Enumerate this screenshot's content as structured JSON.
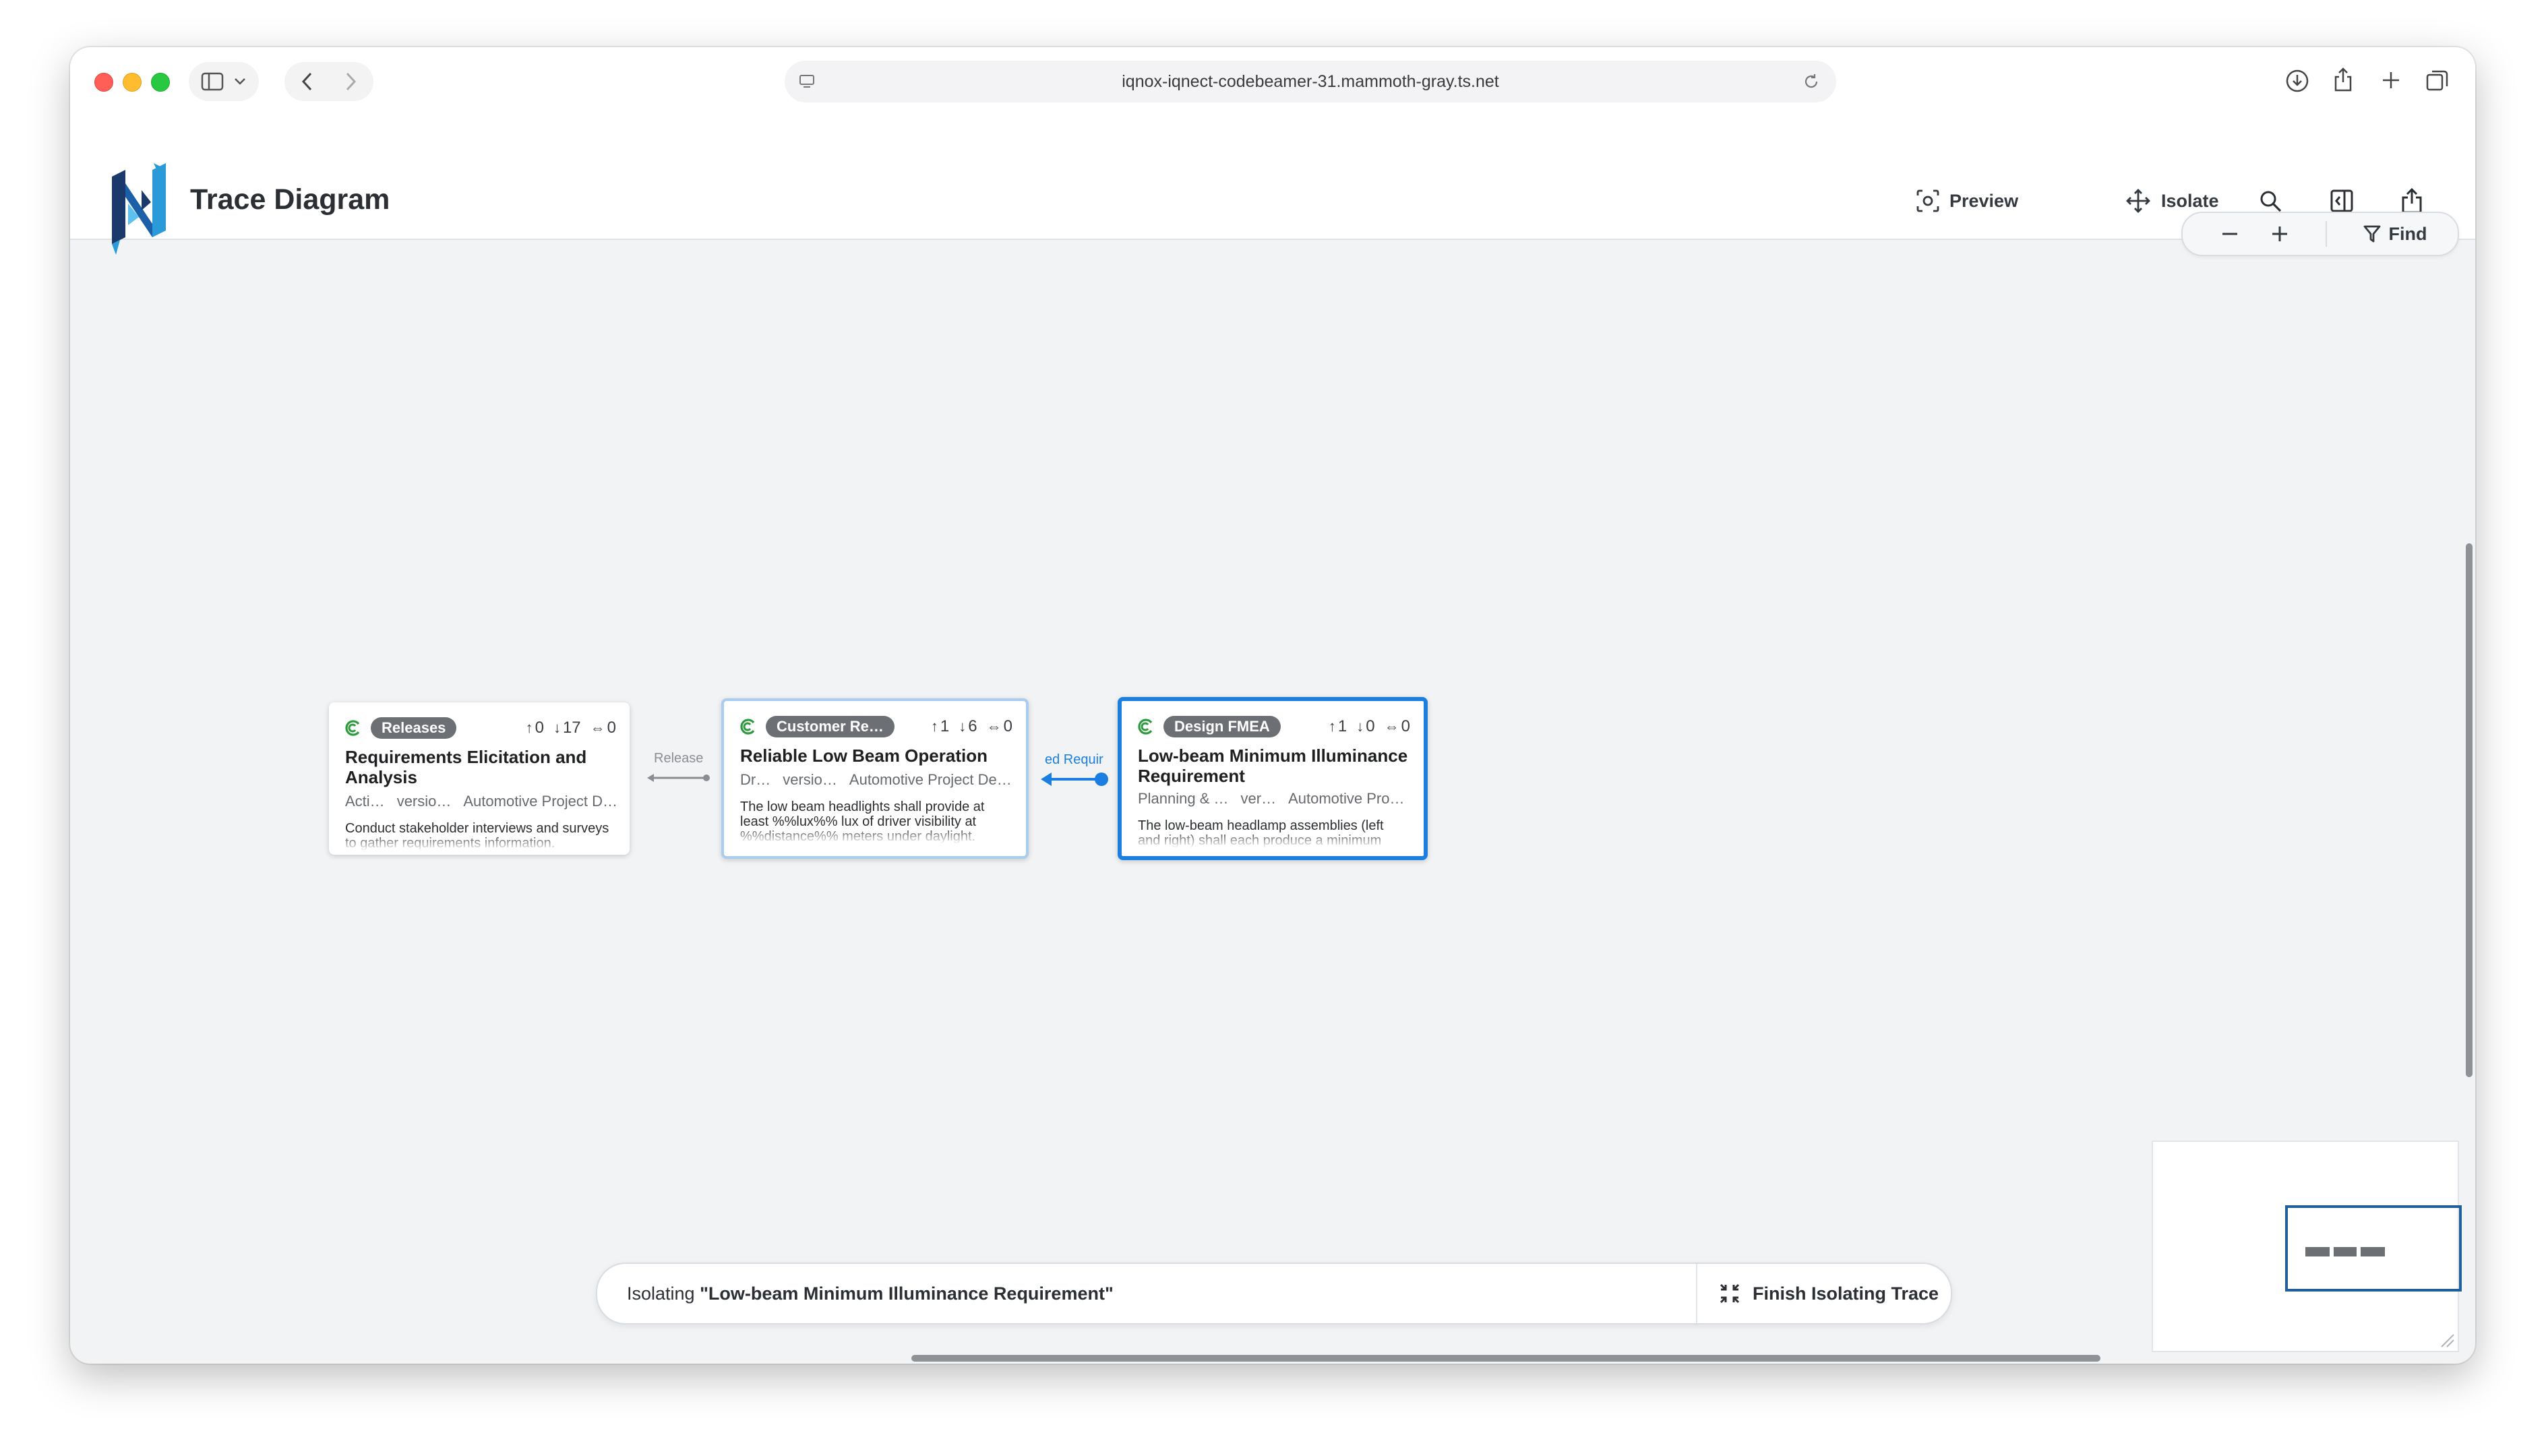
{
  "browser": {
    "url": "iqnox-iqnect-codebeamer-31.mammoth-gray.ts.net"
  },
  "app": {
    "title": "Trace Diagram",
    "logo": "iqnox-logo",
    "actions": {
      "preview": "Preview",
      "isolate": "Isolate"
    },
    "icons": [
      "search-icon",
      "panel-icon",
      "share-icon",
      "close-icon"
    ]
  },
  "canvas": {
    "zoom": {
      "find_label": "Find"
    },
    "nodes": [
      {
        "badge": "Releases",
        "up": "0",
        "down": "17",
        "links": "0",
        "title": "Requirements Elicitation and Analysis",
        "meta": [
          "Acti…",
          "versio…",
          "Automotive Project D…"
        ],
        "description": "Conduct stakeholder interviews and surveys to gather requirements information."
      },
      {
        "badge": "Customer Re…",
        "up": "1",
        "down": "6",
        "links": "0",
        "title": "Reliable Low Beam Operation",
        "meta": [
          "Dr…",
          "versio…",
          "Automotive Project De…"
        ],
        "description": "The low beam headlights shall provide at least %%lux%% lux of driver visibility at %%distance%% meters under daylight."
      },
      {
        "badge": "Design FMEA",
        "up": "1",
        "down": "0",
        "links": "0",
        "title": "Low-beam Minimum Illuminance Requirement",
        "meta": [
          "Planning & …",
          "ver…",
          "Automotive Pro…"
        ],
        "description": "The low-beam headlamp assemblies (left and right) shall each produce a minimum"
      }
    ],
    "edges": [
      {
        "label": "Release",
        "color": "#8a8e93"
      },
      {
        "label": "ed Requir",
        "color": "#1a7fe0"
      }
    ]
  },
  "isolate_bar": {
    "prefix": "Isolating ",
    "item": "\"Low-beam Minimum Illuminance Requirement\"",
    "finish_label": "Finish Isolating Trace"
  },
  "colors": {
    "accent": "#1a7fe0",
    "badge": "#6c6f73",
    "canvas": "#f1f3f5"
  }
}
